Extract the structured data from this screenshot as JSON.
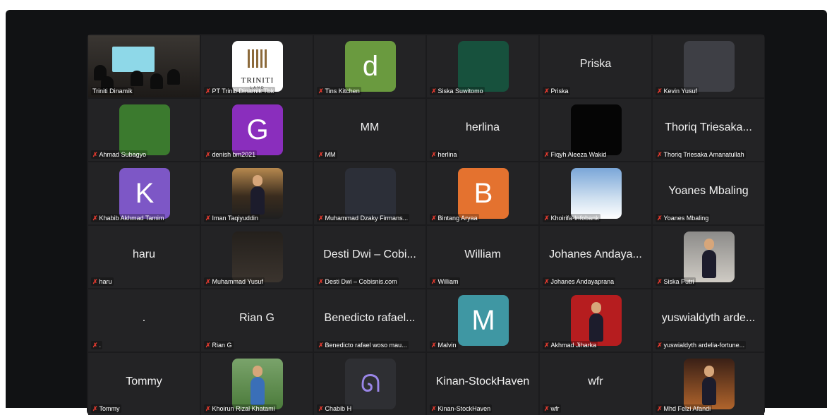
{
  "participants": [
    {
      "name": "Triniti Dinamik",
      "display": "",
      "avatar": "video-room",
      "mic_muted": false,
      "active": true
    },
    {
      "name": "PT Triniti Dinamik Tbk",
      "display": "",
      "avatar": "logo",
      "letter": "",
      "color": "#ffffff",
      "logo_lines": [
        "TRINITI",
        "LAND"
      ],
      "mic_muted": true
    },
    {
      "name": "Tins Kitchen",
      "display": "",
      "avatar": "letter",
      "letter": "d",
      "color": "#6a9a3f",
      "mic_muted": true
    },
    {
      "name": "Siska Suwitomo",
      "display": "",
      "avatar": "color",
      "letter": "",
      "color": "#17513d",
      "mic_muted": true
    },
    {
      "name": "Priska",
      "display": "Priska",
      "avatar": "none",
      "mic_muted": true
    },
    {
      "name": "Kevin Yusuf",
      "display": "",
      "avatar": "color",
      "letter": "",
      "color": "#3e3f45",
      "mic_muted": true
    },
    {
      "name": "Ahmad Subagyo",
      "display": "",
      "avatar": "color",
      "letter": "",
      "color": "#3b7a2e",
      "mic_muted": true
    },
    {
      "name": "denish bm2021",
      "display": "",
      "avatar": "letter",
      "letter": "G",
      "color": "#8a2ebd",
      "mic_muted": true
    },
    {
      "name": "MM",
      "display": "MM",
      "avatar": "none",
      "mic_muted": true
    },
    {
      "name": "herlina",
      "display": "herlina",
      "avatar": "none",
      "mic_muted": true
    },
    {
      "name": "Fiqyh Aleeza Wakid",
      "display": "",
      "avatar": "color",
      "letter": "",
      "color": "#050505",
      "mic_muted": true
    },
    {
      "name": "Thoriq Triesaka Amanatullah",
      "display": "Thoriq Triesaka...",
      "avatar": "none",
      "mic_muted": true
    },
    {
      "name": "Khabib Akhmad Tamim",
      "display": "",
      "avatar": "letter",
      "letter": "K",
      "color": "#7d57c6",
      "mic_muted": true
    },
    {
      "name": "Iman Taqiyuddin",
      "display": "",
      "avatar": "photo-stage",
      "letter": "",
      "color": "#b6884e",
      "mic_muted": true
    },
    {
      "name": "Muhammad Dzaky Firmans...",
      "display": "",
      "avatar": "color",
      "letter": "",
      "color": "#2c2f38",
      "mic_muted": true
    },
    {
      "name": "Bintang Aryaa",
      "display": "",
      "avatar": "letter",
      "letter": "B",
      "color": "#e4722f",
      "mic_muted": true
    },
    {
      "name": "Khoirifa-Infobank",
      "display": "",
      "avatar": "photo-sky",
      "letter": "",
      "color": "#7aa6d8",
      "mic_muted": true
    },
    {
      "name": "Yoanes Mbaling",
      "display": "Yoanes Mbaling",
      "avatar": "none",
      "mic_muted": true
    },
    {
      "name": "haru",
      "display": "haru",
      "avatar": "none",
      "mic_muted": true
    },
    {
      "name": "Muhammad Yusuf",
      "display": "",
      "avatar": "photo-dark",
      "letter": "",
      "color": "#2a2622",
      "mic_muted": true
    },
    {
      "name": "Desti Dwi – Cobisnis.com",
      "display": "Desti Dwi – Cobi...",
      "avatar": "none",
      "mic_muted": true
    },
    {
      "name": "William",
      "display": "William",
      "avatar": "none",
      "mic_muted": true
    },
    {
      "name": "Johanes Andayaprana",
      "display": "Johanes Andaya...",
      "avatar": "none",
      "mic_muted": true
    },
    {
      "name": "Siska Putri",
      "display": "",
      "avatar": "photo-grey",
      "letter": "",
      "color": "#8c8b89",
      "mic_muted": true
    },
    {
      "name": ".",
      "display": ".",
      "avatar": "none",
      "mic_muted": true
    },
    {
      "name": "Rian G",
      "display": "Rian G",
      "avatar": "none",
      "mic_muted": true
    },
    {
      "name": "Benedicto rafael woso mau...",
      "display": "Benedicto rafael...",
      "avatar": "none",
      "mic_muted": true
    },
    {
      "name": "Malvin",
      "display": "",
      "avatar": "letter",
      "letter": "M",
      "color": "#3f97a3",
      "mic_muted": true
    },
    {
      "name": "Akhmad Jiharka",
      "display": "",
      "avatar": "photo-red",
      "letter": "",
      "color": "#b61d1f",
      "mic_muted": true
    },
    {
      "name": "yuswialdyth ardelia-fortune...",
      "display": "yuswialdyth arde...",
      "avatar": "none",
      "mic_muted": true
    },
    {
      "name": "Tommy",
      "display": "Tommy",
      "avatar": "none",
      "mic_muted": true
    },
    {
      "name": "Khoirun Rizal Khatami",
      "display": "",
      "avatar": "photo-field",
      "letter": "",
      "color": "#7aa36b",
      "mic_muted": true
    },
    {
      "name": "Chabib H",
      "display": "",
      "avatar": "glyph",
      "letter": "ᘏ",
      "color": "#2e2f33",
      "mic_muted": true
    },
    {
      "name": "Kinan-StockHaven",
      "display": "Kinan-StockHaven",
      "avatar": "none",
      "mic_muted": true
    },
    {
      "name": "wfr",
      "display": "wfr",
      "avatar": "none",
      "mic_muted": true
    },
    {
      "name": "Mhd Felzi Afandi",
      "display": "",
      "avatar": "photo-warm",
      "letter": "",
      "color": "#b0642c",
      "mic_muted": true
    }
  ],
  "icons": {
    "muted": "mic-muted-icon"
  },
  "colors": {
    "active_speaker": "#3bbf46",
    "muted": "#e0392e",
    "tile_bg": "#232325"
  }
}
